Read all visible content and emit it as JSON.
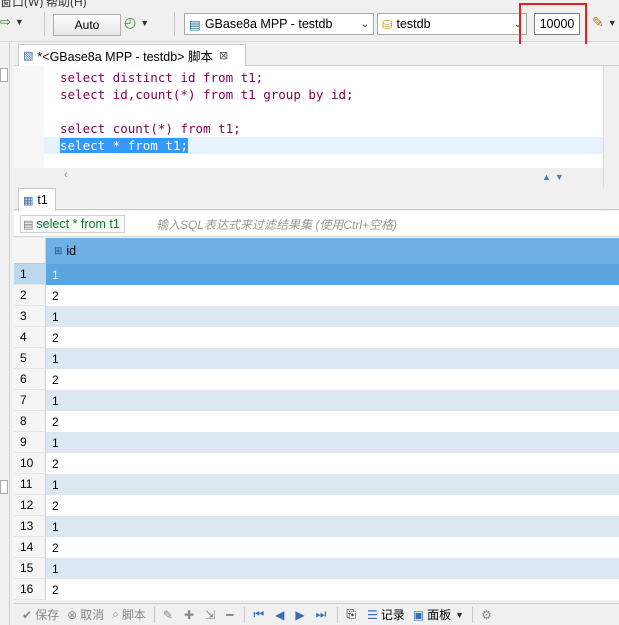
{
  "menu": {
    "items": [
      "窗口(W)",
      "帮助(H)"
    ]
  },
  "toolbar": {
    "commit_mode": "Auto",
    "connection": "GBase8a MPP - testdb",
    "database": "testdb",
    "result_limit": "10000"
  },
  "editor_tab": {
    "title": "*<GBase8a MPP - testdb> 脚本"
  },
  "editor": {
    "lines": [
      [
        "select",
        " distinct id ",
        "from",
        " t1;"
      ],
      [
        "select",
        " id,",
        "count",
        "(*) ",
        "from",
        " t1 ",
        "group",
        " ",
        "by",
        " id;"
      ],
      [
        "select",
        " ",
        "count",
        "(*) ",
        "from",
        " t1;"
      ],
      "select * from t1;"
    ]
  },
  "results_tab": {
    "title": "t1"
  },
  "filter": {
    "current_sql": "select * from t1",
    "placeholder": "输入SQL表达式来过滤结果集 (使用Ctrl+空格)"
  },
  "grid": {
    "column": "id",
    "rows": [
      {
        "n": "1",
        "id": "1"
      },
      {
        "n": "2",
        "id": "2"
      },
      {
        "n": "3",
        "id": "1"
      },
      {
        "n": "4",
        "id": "2"
      },
      {
        "n": "5",
        "id": "1"
      },
      {
        "n": "6",
        "id": "2"
      },
      {
        "n": "7",
        "id": "1"
      },
      {
        "n": "8",
        "id": "2"
      },
      {
        "n": "9",
        "id": "1"
      },
      {
        "n": "10",
        "id": "2"
      },
      {
        "n": "11",
        "id": "1"
      },
      {
        "n": "12",
        "id": "2"
      },
      {
        "n": "13",
        "id": "1"
      },
      {
        "n": "14",
        "id": "2"
      },
      {
        "n": "15",
        "id": "1"
      },
      {
        "n": "16",
        "id": "2"
      }
    ]
  },
  "bottombar": {
    "save": "保存",
    "cancel": "取消",
    "script": "脚本",
    "record": "记录",
    "panel": "面板"
  },
  "colors": {
    "header_blue": "#6fb1e6",
    "selection": "#3399ff",
    "highlight_box": "#e02020"
  }
}
